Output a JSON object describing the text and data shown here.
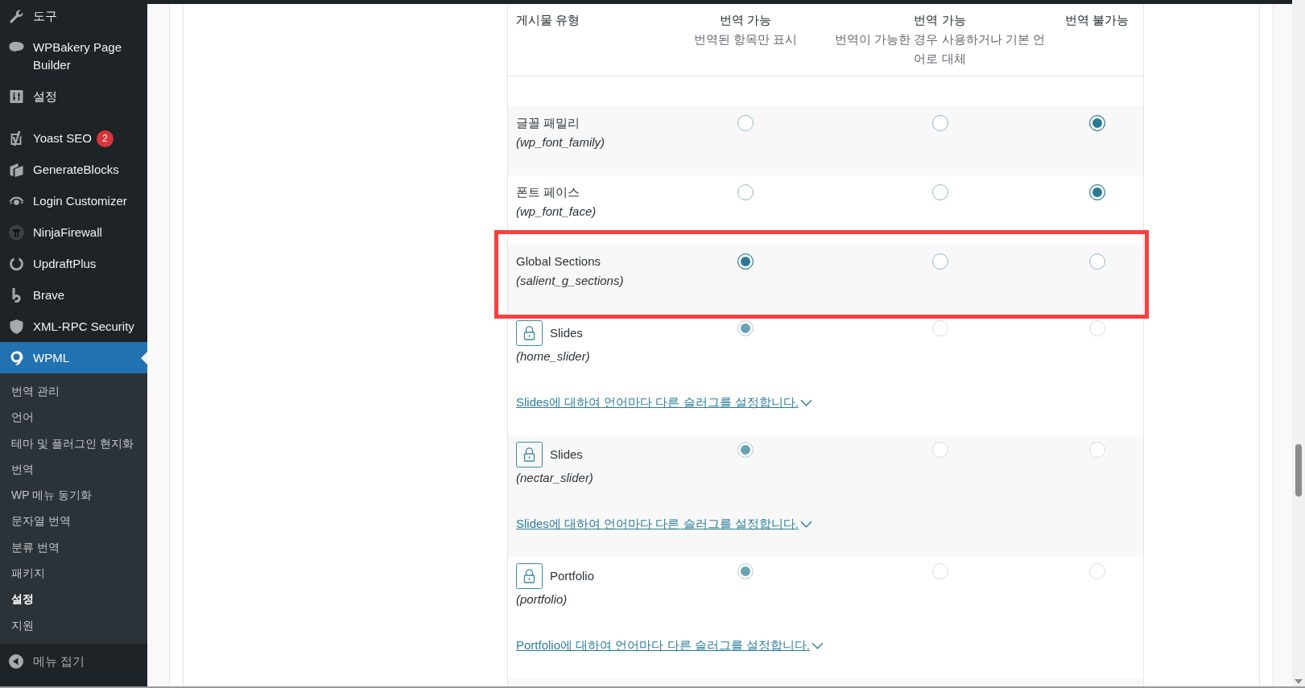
{
  "sidebar": {
    "groups": [
      {
        "items": [
          {
            "label": "도구",
            "selected": false
          },
          {
            "label": "WPBakery Page Builder",
            "selected": false
          },
          {
            "label": "설정",
            "selected": false
          }
        ]
      },
      {
        "items": [
          {
            "label": "Yoast SEO",
            "badge": "2",
            "selected": false
          },
          {
            "label": "GenerateBlocks",
            "selected": false
          },
          {
            "label": "Login Customizer",
            "selected": false
          },
          {
            "label": "NinjaFirewall",
            "selected": false
          },
          {
            "label": "UpdraftPlus",
            "selected": false
          },
          {
            "label": "Brave",
            "selected": false
          },
          {
            "label": "XML-RPC Security",
            "selected": false
          },
          {
            "label": "WPML",
            "selected": true,
            "submenu": [
              {
                "label": "번역 관리",
                "selected": false
              },
              {
                "label": "언어",
                "selected": false
              },
              {
                "label": "테마 및 플러그인 현지화",
                "selected": false
              },
              {
                "label": "번역",
                "selected": false
              },
              {
                "label": "WP 메뉴 동기화",
                "selected": false
              },
              {
                "label": "문자열 번역",
                "selected": false
              },
              {
                "label": "분류 번역",
                "selected": false
              },
              {
                "label": "패키지",
                "selected": false
              },
              {
                "label": "설정",
                "selected": true
              },
              {
                "label": "지원",
                "selected": false
              }
            ]
          }
        ]
      }
    ],
    "collapse": "메뉴 접기"
  },
  "table": {
    "columns": [
      {
        "title": "게시물 유형"
      },
      {
        "title": "번역 가능",
        "subtitle": "번역된 항목만 표시"
      },
      {
        "title": "번역 가능",
        "subtitle": "번역이 가능한 경우 사용하거나 기본 언어로 대체"
      },
      {
        "title": "번역 불가능"
      }
    ],
    "rows": [
      {
        "name": "글꼴 패밀리",
        "slug": "(wp_font_family)",
        "locked": false,
        "highlighted": false,
        "options": [
          {
            "selected": false,
            "disabled": false
          },
          {
            "selected": false,
            "disabled": false
          },
          {
            "selected": true,
            "disabled": false
          }
        ]
      },
      {
        "name": "폰트 페이스",
        "slug": "(wp_font_face)",
        "locked": false,
        "highlighted": false,
        "options": [
          {
            "selected": false,
            "disabled": false
          },
          {
            "selected": false,
            "disabled": false
          },
          {
            "selected": true,
            "disabled": false
          }
        ]
      },
      {
        "name": "Global Sections",
        "slug": "(salient_g_sections)",
        "locked": false,
        "highlighted": true,
        "options": [
          {
            "selected": true,
            "disabled": false
          },
          {
            "selected": false,
            "disabled": false
          },
          {
            "selected": false,
            "disabled": false
          }
        ]
      },
      {
        "name": "Slides",
        "slug": "(home_slider)",
        "locked": true,
        "highlighted": false,
        "link": "Slides에 대하여 언어마다 다른 슬러그를 설정합니다.",
        "options": [
          {
            "selected": true,
            "disabled": true
          },
          {
            "selected": false,
            "disabled": true
          },
          {
            "selected": false,
            "disabled": true
          }
        ]
      },
      {
        "name": "Slides",
        "slug": "(nectar_slider)",
        "locked": true,
        "highlighted": false,
        "link": "Slides에 대하여 언어마다 다른 슬러그를 설정합니다.",
        "options": [
          {
            "selected": true,
            "disabled": true
          },
          {
            "selected": false,
            "disabled": true
          },
          {
            "selected": false,
            "disabled": true
          }
        ]
      },
      {
        "name": "Portfolio",
        "slug": "(portfolio)",
        "locked": true,
        "highlighted": false,
        "link": "Portfolio에 대하여 언어마다 다른 슬러그를 설정합니다.",
        "options": [
          {
            "selected": true,
            "disabled": true
          },
          {
            "selected": false,
            "disabled": true
          },
          {
            "selected": false,
            "disabled": true
          }
        ]
      }
    ]
  }
}
